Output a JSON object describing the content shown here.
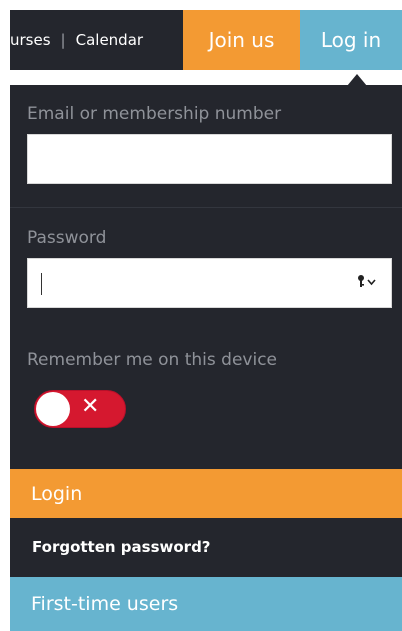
{
  "nav": {
    "courses_label": "urses",
    "separator": "|",
    "calendar_label": "Calendar",
    "join_label": "Join us",
    "login_tab_label": "Log in"
  },
  "form": {
    "email_label": "Email or membership number",
    "email_value": "",
    "password_label": "Password",
    "password_value": "",
    "password_manager_icon": "key-icon",
    "remember_label": "Remember me on this device",
    "remember_state": "off",
    "toggle_glyph": "✕",
    "login_button_label": "Login",
    "forgot_label": "Forgotten password?",
    "first_time_label": "First-time users"
  },
  "colors": {
    "panel_bg": "#24262d",
    "orange": "#f39a33",
    "blue": "#67b4cf",
    "toggle_red": "#d5182f"
  }
}
